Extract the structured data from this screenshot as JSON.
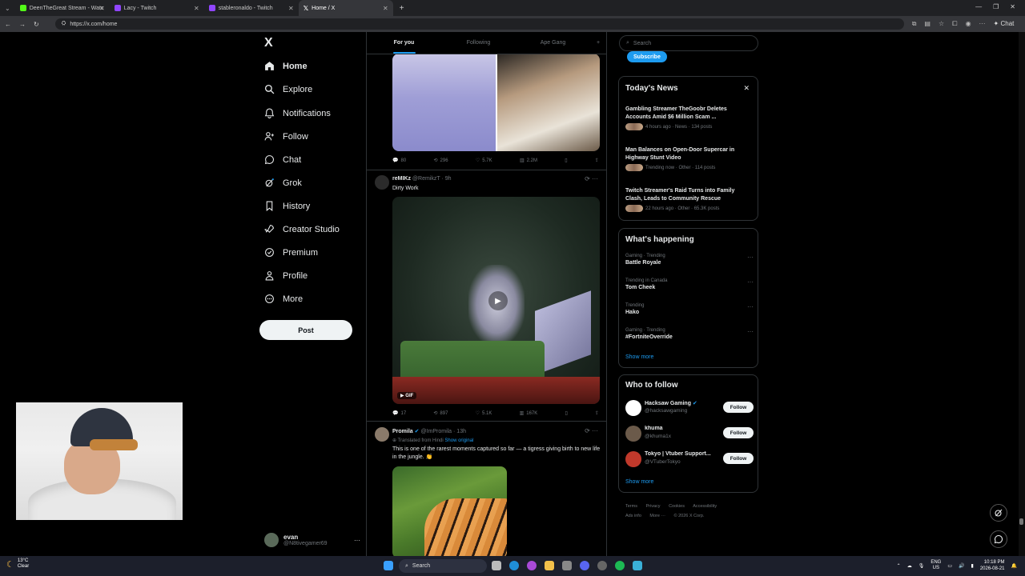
{
  "browser": {
    "tabs": [
      {
        "label": "DeenTheGreat Stream - Watc",
        "color": "#53fc18"
      },
      {
        "label": "Lacy - Twitch",
        "color": "#9146ff"
      },
      {
        "label": "stableronaldo - Twitch",
        "color": "#9146ff"
      },
      {
        "label": "Home / X",
        "color": "#ffffff"
      }
    ],
    "url": "https://x.com/home",
    "chat_label": "Chat"
  },
  "nav": {
    "logo": "X",
    "items": [
      {
        "label": "Home",
        "icon": "home-icon"
      },
      {
        "label": "Explore",
        "icon": "search-icon"
      },
      {
        "label": "Notifications",
        "icon": "bell-icon"
      },
      {
        "label": "Follow",
        "icon": "person-plus-icon"
      },
      {
        "label": "Chat",
        "icon": "chat-bubble-icon"
      },
      {
        "label": "Grok",
        "icon": "grok-icon"
      },
      {
        "label": "History",
        "icon": "bookmark-icon"
      },
      {
        "label": "Creator Studio",
        "icon": "rocket-icon"
      },
      {
        "label": "Premium",
        "icon": "verified-icon"
      },
      {
        "label": "Profile",
        "icon": "person-icon"
      },
      {
        "label": "More",
        "icon": "more-circle-icon"
      }
    ],
    "post_label": "Post",
    "account": {
      "name": "evan",
      "handle": "@N8tivegamer69"
    }
  },
  "feed": {
    "tabs": [
      "For you",
      "Following",
      "Ape Gang"
    ],
    "tweets": [
      {
        "name": "",
        "handle": "",
        "time": "",
        "text": "",
        "stats": {
          "replies": "80",
          "reposts": "296",
          "likes": "5.7K",
          "views": "2.2M"
        }
      },
      {
        "name": "reMIKz",
        "handle": "@RemikzT · 9h",
        "text": "Dirty Work",
        "media_badge": "GIF",
        "stats": {
          "replies": "17",
          "reposts": "897",
          "likes": "5.1K",
          "views": "167K"
        }
      },
      {
        "name": "Promila",
        "handle": "@ImPromila · 13h",
        "translated": "Translated from Hindi",
        "show_original": "Show original",
        "text": "This is one of the rarest moments captured so far — a tigress giving birth to new life in the jungle. 👏"
      }
    ]
  },
  "right": {
    "search_placeholder": "Search",
    "subscribe_label": "Subscribe",
    "news": {
      "title": "Today's News",
      "items": [
        {
          "title": "Gambling Streamer TheGoobr Deletes Accounts Amid $6 Million Scam ...",
          "meta": "4 hours ago · News · 134 posts"
        },
        {
          "title": "Man Balances on Open-Door Supercar in Highway Stunt Video",
          "meta": "Trending now · Other · 114 posts"
        },
        {
          "title": "Twitch Streamer's Raid Turns into Family Clash, Leads to Community Rescue",
          "meta": "22 hours ago · Other · 65.3K posts"
        }
      ]
    },
    "happening": {
      "title": "What's happening",
      "items": [
        {
          "context": "Gaming · Trending",
          "name": "Battle Royale"
        },
        {
          "context": "Trending in Canada",
          "name": "Tom Cheek"
        },
        {
          "context": "Trending",
          "name": "Hako"
        },
        {
          "context": "Gaming · Trending",
          "name": "#FortniteOverride"
        }
      ],
      "show_more": "Show more"
    },
    "who_to_follow": {
      "title": "Who to follow",
      "items": [
        {
          "name": "Hacksaw Gaming",
          "handle": "@hacksawgaming",
          "verified": true,
          "color": "#ffffff"
        },
        {
          "name": "khuma",
          "handle": "@khuma1x",
          "verified": false,
          "color": "#6b5a4a"
        },
        {
          "name": "Tokyo | Vtuber Support...",
          "handle": "@VTuberTokyo",
          "verified": false,
          "color": "#c0392b"
        }
      ],
      "follow_label": "Follow",
      "show_more": "Show more"
    },
    "footer": [
      "Terms",
      "Privacy",
      "Cookies",
      "Accessibility",
      "Ads info",
      "More ···",
      "© 2026 X Corp."
    ]
  },
  "taskbar": {
    "weather_temp": "13°C",
    "weather_desc": "Clear",
    "search_label": "Search",
    "lang": "ENG",
    "region": "US",
    "time": "10:18 PM",
    "date": "2026-08-21"
  },
  "colors": {
    "accent": "#1d9bf0",
    "background": "#000000",
    "border": "#2f3336"
  }
}
